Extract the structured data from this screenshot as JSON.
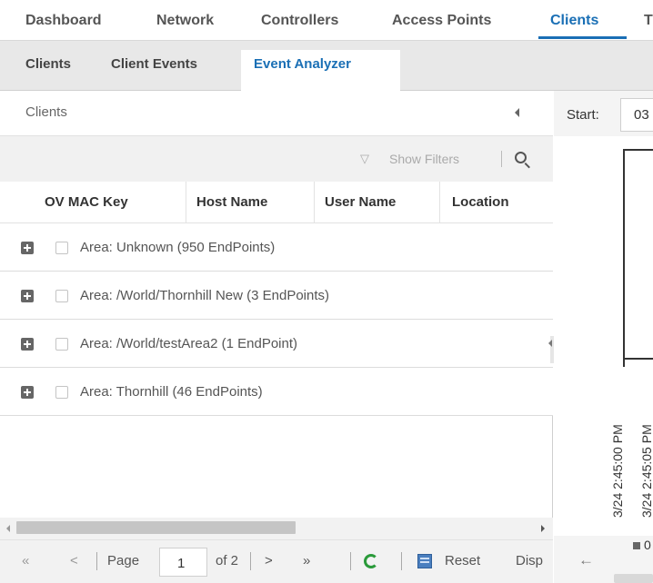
{
  "top_nav": {
    "items": [
      {
        "label": "Dashboard"
      },
      {
        "label": "Network"
      },
      {
        "label": "Controllers"
      },
      {
        "label": "Access Points"
      },
      {
        "label": "Clients",
        "active": true
      },
      {
        "label": "T"
      }
    ]
  },
  "sub_tabs": {
    "items": [
      {
        "label": "Clients"
      },
      {
        "label": "Client Events"
      },
      {
        "label": "Event Analyzer",
        "active": true
      }
    ]
  },
  "left_panel": {
    "title": "Clients",
    "filters_label": "Show Filters",
    "columns": [
      "OV MAC Key",
      "Host Name",
      "User Name",
      "Location"
    ],
    "groups": [
      {
        "label": "Area: Unknown (950 EndPoints)"
      },
      {
        "label": "Area: /World/Thornhill New (3 EndPoints)"
      },
      {
        "label": "Area: /World/testArea2 (1 EndPoint)"
      },
      {
        "label": "Area: Thornhill (46 EndPoints)"
      }
    ],
    "pager": {
      "first": "«",
      "prev": "<",
      "page_label": "Page",
      "page_value": "1",
      "of_label": "of 2",
      "next": ">",
      "last": "»",
      "reset_label": "Reset",
      "display_label": "Disp"
    }
  },
  "right_panel": {
    "start_label": "Start:",
    "start_value": "03",
    "x_labels": [
      "3/24 2:45:00 PM",
      "3/24 2:45:05 PM"
    ],
    "back_arrow": "←",
    "legend_value": "0"
  },
  "colors": {
    "accent": "#1a6fb5",
    "refresh": "#2a9a3a"
  },
  "icons": [
    "collapse-left-icon",
    "filter-icon",
    "search-icon",
    "expand-icon",
    "refresh-icon",
    "reset-icon",
    "back-arrow-icon"
  ]
}
